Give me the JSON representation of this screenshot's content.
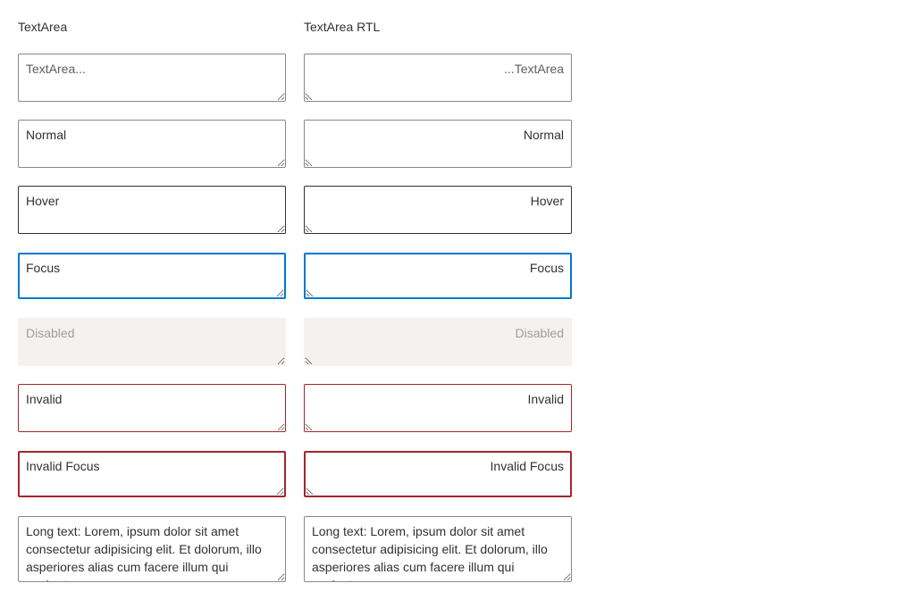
{
  "ltr": {
    "title": "TextArea",
    "fields": {
      "placeholder": "TextArea...",
      "normal": "Normal",
      "hover": "Hover",
      "focus": "Focus",
      "disabled": "Disabled",
      "invalid": "Invalid",
      "invalid_focus": "Invalid Focus",
      "long": "Long text: Lorem, ipsum dolor sit amet consectetur adipisicing elit. Et dolorum, illo asperiores alias cum facere illum qui sapiente"
    }
  },
  "rtl": {
    "title": "TextArea RTL",
    "fields": {
      "placeholder": "TextArea...",
      "normal": "Normal",
      "hover": "Hover",
      "focus": "Focus",
      "disabled": "Disabled",
      "invalid": "Invalid",
      "invalid_focus": "Invalid Focus",
      "long": "Long text: Lorem, ipsum dolor sit amet consectetur adipisicing elit. Et dolorum, illo asperiores alias cum facere illum qui sapiente"
    }
  },
  "colors": {
    "border": "#8a8886",
    "border_hover": "#323130",
    "focus": "#0078d4",
    "invalid": "#a4262c",
    "disabled_bg": "#f3f2f1",
    "text": "#323130"
  }
}
